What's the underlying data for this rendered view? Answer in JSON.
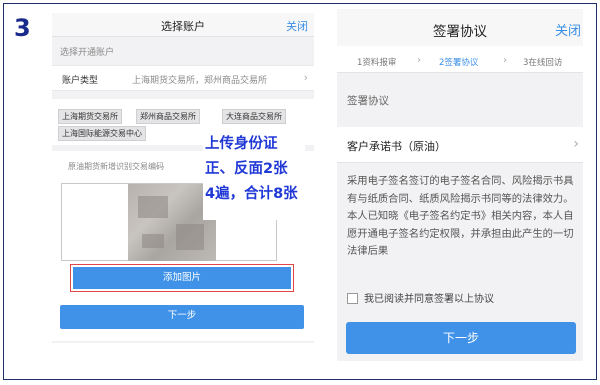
{
  "step_number": "3",
  "left": {
    "header": {
      "title": "选择账户",
      "close_label": "关闭"
    },
    "section_label": "选择开通账户",
    "account_type": {
      "label": "账户类型",
      "value": "上海期货交易所，郑州商品交易所"
    },
    "exchanges": [
      "上海期货交易所",
      "郑州商品交易所",
      "大连商品交易所",
      "上海国际能源交易中心"
    ],
    "upload_hint": "原油期货新增识别交易编码",
    "annotation": {
      "line1": "上传身份证",
      "line2": "正、反面2张",
      "line3": "4遍，合计8张"
    },
    "add_image_label": "添加图片",
    "next_label": "下一步"
  },
  "right": {
    "header": {
      "title": "签署协议",
      "close_label": "关闭"
    },
    "steps": [
      "1资料报审",
      "2签署协议",
      "3在线回访"
    ],
    "active_step": 1,
    "section_label": "签署协议",
    "document_label": "客户承诺书（原油）",
    "body_text": "采用电子签名签订的电子签名合同、风险揭示书具有与纸质合同、纸质风险揭示书同等的法律效力。本人已知晓《电子签名约定书》相关内容，本人自愿开通电子签名约定权限，并承担由此产生的一切法律后果",
    "agree_label": "我已阅读并同意签署以上协议",
    "next_label": "下一步"
  },
  "colors": {
    "accent": "#3f92e8",
    "annotation": "#1f38d6",
    "highlight_border": "#e04848",
    "frame": "#1f2f6e"
  }
}
